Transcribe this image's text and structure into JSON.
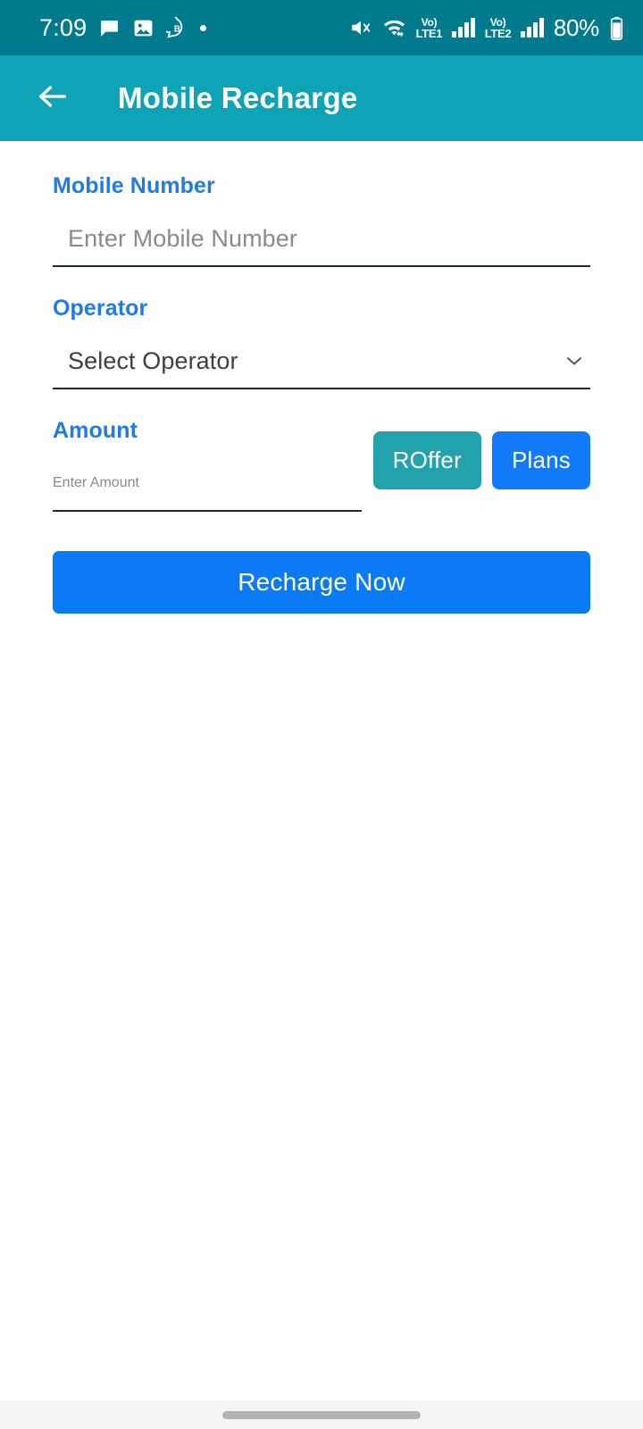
{
  "status_bar": {
    "time": "7:09",
    "battery_percent": "80%",
    "left_icons": [
      "message-bubble-icon",
      "image-icon",
      "circled-b-icon",
      "dot-indicator"
    ],
    "right_icons": [
      "mute-icon",
      "wifi-icon",
      "volte-1-icon",
      "signal-1-icon",
      "volte-2-icon",
      "signal-2-icon",
      "battery-icon"
    ],
    "volte1_label_top": "Vo)",
    "volte1_label_bottom": "LTE1",
    "volte2_label_top": "Vo)",
    "volte2_label_bottom": "LTE2",
    "background_color": "#007A8C"
  },
  "app_bar": {
    "title": "Mobile Recharge",
    "back_icon": "arrow-left-icon",
    "background_color": "#0FA3B7"
  },
  "form": {
    "mobile_number": {
      "label": "Mobile Number",
      "placeholder": "Enter Mobile Number",
      "value": ""
    },
    "operator": {
      "label": "Operator",
      "selected": "Select Operator",
      "dropdown_icon": "chevron-down-icon"
    },
    "amount": {
      "label": "Amount",
      "placeholder": "Enter Amount",
      "value": "",
      "roffer_label": "ROffer",
      "plans_label": "Plans",
      "roffer_color": "#21A2AC",
      "plans_color": "#1279F7"
    },
    "submit": {
      "label": "Recharge Now",
      "color": "#0B7BF5"
    },
    "label_color": "#1E7BE8"
  },
  "nav_bar": {
    "handle": "gesture-home-pill"
  }
}
